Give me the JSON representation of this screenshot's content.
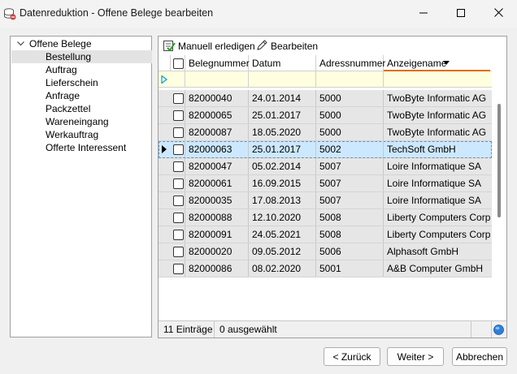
{
  "window": {
    "title": "Datenreduktion - Offene Belege bearbeiten"
  },
  "tree": {
    "root_label": "Offene Belege",
    "items": [
      {
        "label": "Bestellung",
        "selected": true
      },
      {
        "label": "Auftrag",
        "selected": false
      },
      {
        "label": "Lieferschein",
        "selected": false
      },
      {
        "label": "Anfrage",
        "selected": false
      },
      {
        "label": "Packzettel",
        "selected": false
      },
      {
        "label": "Wareneingang",
        "selected": false
      },
      {
        "label": "Werkauftrag",
        "selected": false
      },
      {
        "label": "Offerte Interessent",
        "selected": false
      }
    ]
  },
  "toolbar": {
    "manual_label": "Manuell erledigen",
    "edit_label": "Bearbeiten"
  },
  "grid": {
    "columns": [
      "Belegnummer",
      "Datum",
      "Adressnummer",
      "Anzeigename"
    ],
    "sorted_column": "Anzeigename",
    "rows": [
      {
        "belegnummer": "82000040",
        "datum": "24.01.2014",
        "adressnummer": "5000",
        "anzeigename": "TwoByte Informatic AG",
        "selected": false
      },
      {
        "belegnummer": "82000065",
        "datum": "25.01.2017",
        "adressnummer": "5000",
        "anzeigename": "TwoByte Informatic AG",
        "selected": false
      },
      {
        "belegnummer": "82000087",
        "datum": "18.05.2020",
        "adressnummer": "5000",
        "anzeigename": "TwoByte Informatic AG",
        "selected": false
      },
      {
        "belegnummer": "82000063",
        "datum": "25.01.2017",
        "adressnummer": "5002",
        "anzeigename": "TechSoft GmbH",
        "selected": true
      },
      {
        "belegnummer": "82000047",
        "datum": "05.02.2014",
        "adressnummer": "5007",
        "anzeigename": "Loire Informatique SA",
        "selected": false
      },
      {
        "belegnummer": "82000061",
        "datum": "16.09.2015",
        "adressnummer": "5007",
        "anzeigename": "Loire Informatique SA",
        "selected": false
      },
      {
        "belegnummer": "82000035",
        "datum": "17.08.2013",
        "adressnummer": "5007",
        "anzeigename": "Loire Informatique SA",
        "selected": false
      },
      {
        "belegnummer": "82000088",
        "datum": "12.10.2020",
        "adressnummer": "5008",
        "anzeigename": "Liberty Computers Corp.",
        "selected": false
      },
      {
        "belegnummer": "82000091",
        "datum": "24.05.2021",
        "adressnummer": "5008",
        "anzeigename": "Liberty Computers Corp.",
        "selected": false
      },
      {
        "belegnummer": "82000020",
        "datum": "09.05.2012",
        "adressnummer": "5006",
        "anzeigename": "Alphasoft GmbH",
        "selected": false
      },
      {
        "belegnummer": "82000086",
        "datum": "08.02.2020",
        "adressnummer": "5001",
        "anzeigename": "A&B Computer GmbH",
        "selected": false
      }
    ]
  },
  "status": {
    "count_text": "11 Einträge",
    "selected_text": "0 ausgewählt"
  },
  "buttons": {
    "back_label": "< Zurück",
    "next_label": "Weiter >",
    "cancel_label": "Abbrechen"
  },
  "colors": {
    "accent_sort": "#e36c0a",
    "filter_row": "#ffffe0",
    "selected_row": "#cce8ff",
    "row_bg": "#e6e6e6",
    "indicator": "#00a0c0"
  },
  "icons": {
    "app": "database-icon",
    "manual": "checklist-icon",
    "edit": "pencil-icon",
    "status": "globe-icon"
  }
}
